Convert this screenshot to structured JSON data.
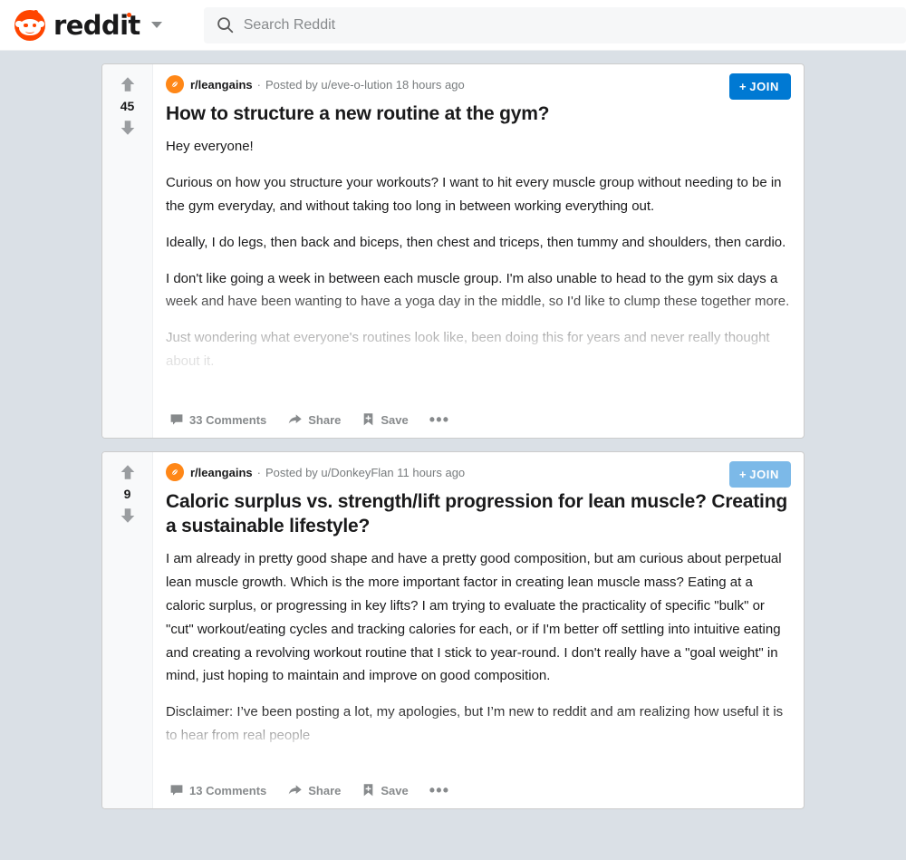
{
  "header": {
    "logo_text": "reddit",
    "logo_icon": "reddit-snoo-logo",
    "dropdown_icon": "chevron-down-icon",
    "search": {
      "icon": "search-icon",
      "placeholder": "Search Reddit",
      "value": ""
    }
  },
  "colors": {
    "page_background": "#dae0e6",
    "card_background": "#ffffff",
    "brand_orange": "#ff4500",
    "subreddit_icon_orange": "#ff8717",
    "join_blue": "#0079d3",
    "join_blue_light": "#7cb9e8",
    "text_primary": "#1a1a1b",
    "text_muted": "#787c7e",
    "action_gray": "#878a8c"
  },
  "posts": [
    {
      "score": "45",
      "upvote_icon": "upvote-arrow-icon",
      "downvote_icon": "downvote-arrow-icon",
      "subreddit_icon": "leangains-subreddit-icon",
      "subreddit": "r/leangains",
      "separator": "·",
      "byline": "Posted by u/eve-o-lution 18 hours ago",
      "join_label": "JOIN",
      "join_plus": "+",
      "title": "How to structure a new routine at the gym?",
      "paragraphs": [
        "Hey everyone!",
        "Curious on how you structure your workouts? I want to hit every muscle group without needing to be in the gym everyday, and without taking too long in between working everything out.",
        "Ideally, I do legs, then back and biceps, then chest and triceps, then tummy and shoulders, then cardio.",
        "I don't like going a week in between each muscle group. I'm also unable to head to the gym six days a week and have been wanting to have a yoga day in the middle, so I'd like to clump these together more.",
        "Just wondering what everyone's routines look like, been doing this for years and never really thought about it."
      ],
      "actions": {
        "comments_icon": "comment-bubble-icon",
        "comments_label": "33 Comments",
        "share_icon": "share-arrow-icon",
        "share_label": "Share",
        "save_icon": "save-bookmark-icon",
        "save_label": "Save",
        "more_icon": "ellipsis-icon",
        "more_label": "•••"
      }
    },
    {
      "score": "9",
      "upvote_icon": "upvote-arrow-icon",
      "downvote_icon": "downvote-arrow-icon",
      "subreddit_icon": "leangains-subreddit-icon",
      "subreddit": "r/leangains",
      "separator": "·",
      "byline": "Posted by u/DonkeyFlan 11 hours ago",
      "join_label": "JOIN",
      "join_plus": "+",
      "title": "Caloric surplus vs. strength/lift progression for lean muscle? Creating a sustainable lifestyle?",
      "paragraphs": [
        "I am already in pretty good shape and have a pretty good composition, but am curious about perpetual lean muscle growth. Which is the more important factor in creating lean muscle mass? Eating at a caloric surplus, or progressing in key lifts? I am trying to evaluate the practicality of specific \"bulk\" or \"cut\" workout/eating cycles and tracking calories for each, or if I'm better off settling into intuitive eating and creating a revolving workout routine that I stick to year-round. I don't really have a \"goal weight\" in mind, just hoping to maintain and improve on good composition.",
        "Disclaimer: I’ve been posting a lot, my apologies, but I’m new to reddit and am realizing how useful it is to hear from real people"
      ],
      "actions": {
        "comments_icon": "comment-bubble-icon",
        "comments_label": "13 Comments",
        "share_icon": "share-arrow-icon",
        "share_label": "Share",
        "save_icon": "save-bookmark-icon",
        "save_label": "Save",
        "more_icon": "ellipsis-icon",
        "more_label": "•••"
      }
    }
  ]
}
